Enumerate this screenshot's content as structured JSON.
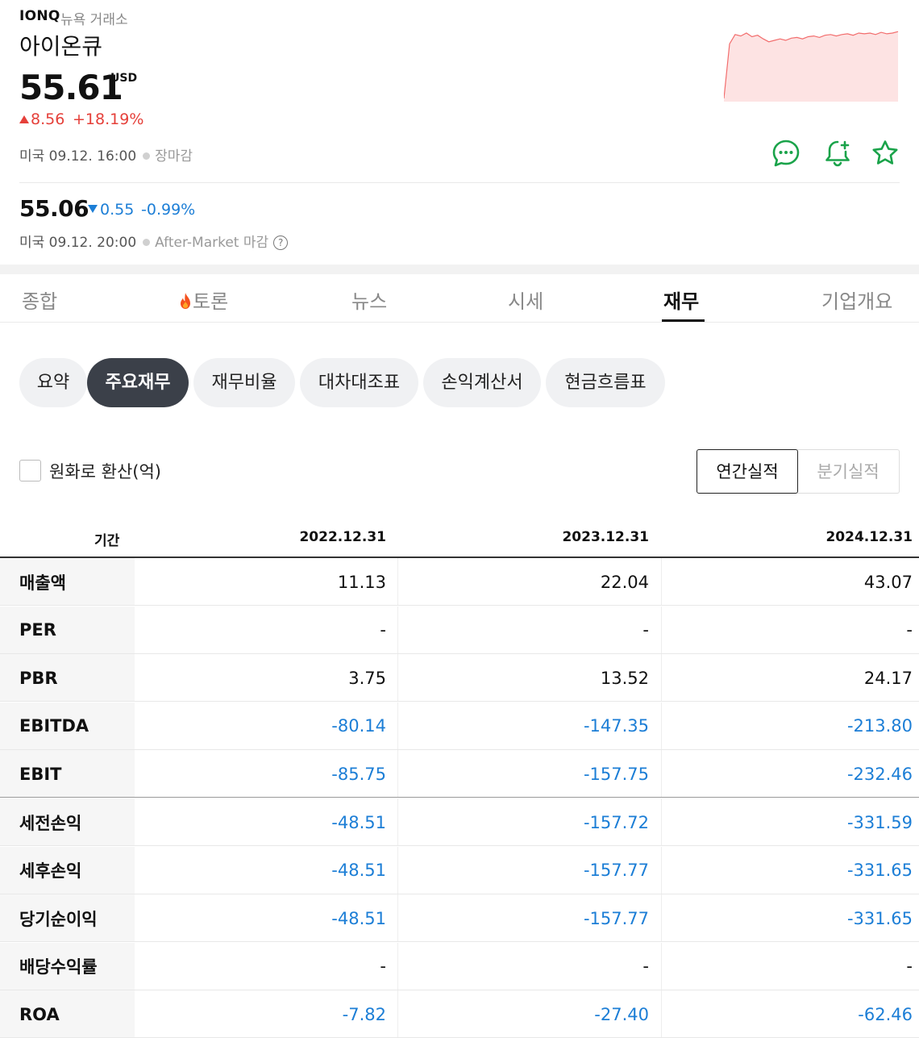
{
  "header": {
    "ticker": "IONQ",
    "exchange": "뉴욕 거래소",
    "name": "아이온큐",
    "price": "55.61",
    "currency": "USD",
    "change": "8.56",
    "change_pct": "+18.19%",
    "market_time": "미국 09.12. 16:00",
    "market_status": "장마감",
    "up_color": "#e5403a",
    "down_color": "#1c7ed6"
  },
  "after_market": {
    "price": "55.06",
    "change": "0.55",
    "change_pct": "-0.99%",
    "time": "미국 09.12. 20:00",
    "label": "After-Market 마감",
    "help_icon": "?"
  },
  "actions": {
    "icons": [
      "chat-icon",
      "bell-plus-icon",
      "star-icon"
    ],
    "accent": "#1aa34a"
  },
  "tabs": [
    {
      "label": "종합"
    },
    {
      "label": "토론",
      "icon": "fire-icon"
    },
    {
      "label": "뉴스"
    },
    {
      "label": "시세"
    },
    {
      "label": "재무",
      "active": true
    },
    {
      "label": "기업개요"
    }
  ],
  "subtabs": [
    {
      "label": "요약"
    },
    {
      "label": "주요재무",
      "active": true
    },
    {
      "label": "재무비율"
    },
    {
      "label": "대차대조표"
    },
    {
      "label": "손익계산서"
    },
    {
      "label": "현금흐름표"
    }
  ],
  "options": {
    "krw_convert": "원화로 환산(억)",
    "annual": "연간실적",
    "quarterly": "분기실적",
    "selected": "연간실적"
  },
  "table": {
    "header_label": "기간",
    "columns": [
      "2022.12.31",
      "2023.12.31",
      "2024.12.31"
    ],
    "rows": [
      {
        "label": "매출액",
        "values": [
          "11.13",
          "22.04",
          "43.07"
        ]
      },
      {
        "label": "PER",
        "values": [
          "-",
          "-",
          "-"
        ]
      },
      {
        "label": "PBR",
        "values": [
          "3.75",
          "13.52",
          "24.17"
        ]
      },
      {
        "label": "EBITDA",
        "values": [
          "-80.14",
          "-147.35",
          "-213.80"
        ]
      },
      {
        "label": "EBIT",
        "values": [
          "-85.75",
          "-157.75",
          "-232.46"
        ]
      },
      {
        "label": "세전손익",
        "values": [
          "-48.51",
          "-157.72",
          "-331.59"
        ]
      },
      {
        "label": "세후손익",
        "values": [
          "-48.51",
          "-157.77",
          "-331.65"
        ]
      },
      {
        "label": "당기순이익",
        "values": [
          "-48.51",
          "-157.77",
          "-331.65"
        ]
      },
      {
        "label": "배당수익률",
        "values": [
          "-",
          "-",
          "-"
        ]
      },
      {
        "label": "ROA",
        "values": [
          "-7.82",
          "-27.40",
          "-62.46"
        ]
      }
    ]
  },
  "sparkline": {
    "type": "area",
    "values": [
      0,
      0.75,
      0.88,
      0.86,
      0.9,
      0.85,
      0.87,
      0.82,
      0.78,
      0.8,
      0.82,
      0.8,
      0.83,
      0.84,
      0.82,
      0.85,
      0.86,
      0.84,
      0.87,
      0.88,
      0.86,
      0.88,
      0.89,
      0.87,
      0.9,
      0.89,
      0.9,
      0.88,
      0.91,
      0.89,
      0.9,
      0.92
    ],
    "line_color": "#f26d6d",
    "fill_color": "#fde3e3"
  }
}
